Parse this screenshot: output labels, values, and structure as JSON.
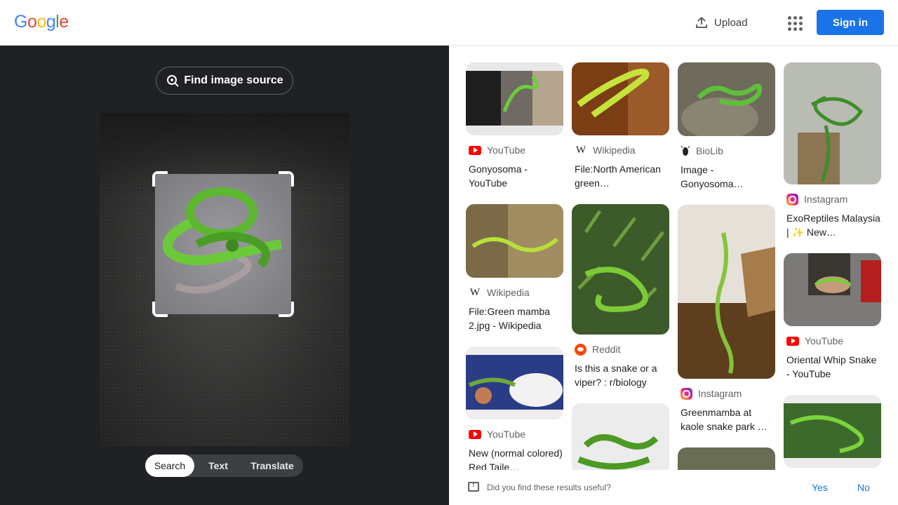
{
  "header": {
    "logo": "Google",
    "upload_label": "Upload",
    "signin_label": "Sign in"
  },
  "left": {
    "find_source_label": "Find image source",
    "modes": [
      "Search",
      "Text",
      "Translate"
    ],
    "active_mode": "Search"
  },
  "results": {
    "col1": [
      {
        "source": "YouTube",
        "source_icon": "youtube-icon",
        "title": "Gonyosoma - YouTube"
      },
      {
        "source": "Wikipedia",
        "source_icon": "wikipedia-icon",
        "title": "File:Green mamba 2.jpg - Wikipedia"
      },
      {
        "source": "YouTube",
        "source_icon": "youtube-icon",
        "title": "New (normal colored) Red Taile…"
      }
    ],
    "col2": [
      {
        "source": "Wikipedia",
        "source_icon": "wikipedia-icon",
        "title": "File:North American green…"
      },
      {
        "source": "Reddit",
        "source_icon": "reddit-icon",
        "title": "Is this a snake or a viper? : r/biology"
      },
      {
        "source": "",
        "source_icon": "",
        "title": ""
      }
    ],
    "col3": [
      {
        "source": "BioLib",
        "source_icon": "biolib-icon",
        "title": "Image - Gonyosoma…"
      },
      {
        "source": "Instagram",
        "source_icon": "instagram-icon",
        "title": "Greenmamba at kaole snake park …"
      },
      {
        "source": "",
        "source_icon": "",
        "title": ""
      }
    ],
    "col4": [
      {
        "source": "Instagram",
        "source_icon": "instagram-icon",
        "title": "ExoReptiles Malaysia | ✨ New…"
      },
      {
        "source": "YouTube",
        "source_icon": "youtube-icon",
        "title": "Oriental Whip Snake - YouTube"
      },
      {
        "source": "",
        "source_icon": "",
        "title": ""
      }
    ]
  },
  "feedback": {
    "question": "Did you find these results useful?",
    "yes": "Yes",
    "no": "No"
  },
  "colors": {
    "accent": "#1a73e8",
    "left_panel_bg": "#202124"
  }
}
